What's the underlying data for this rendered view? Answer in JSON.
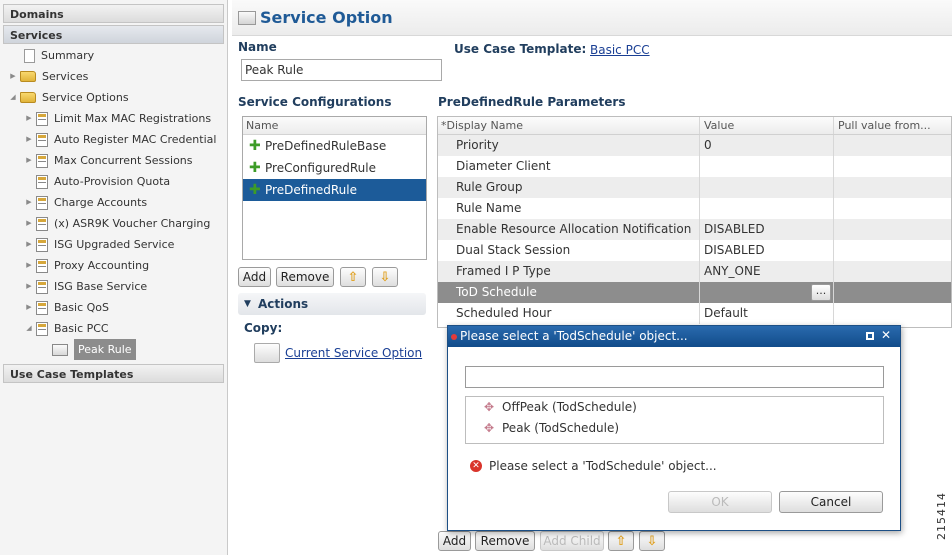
{
  "nav": {
    "domains": "Domains",
    "services": "Services",
    "use_case_templates": "Use Case Templates",
    "tree": [
      {
        "label": "Summary"
      },
      {
        "label": "Services"
      },
      {
        "label": "Service Options"
      },
      {
        "label": "Limit Max MAC Registrations"
      },
      {
        "label": "Auto Register MAC Credential"
      },
      {
        "label": "Max Concurrent Sessions"
      },
      {
        "label": "Auto-Provision Quota"
      },
      {
        "label": "Charge Accounts"
      },
      {
        "label": "(x) ASR9K Voucher Charging"
      },
      {
        "label": "ISG Upgraded Service"
      },
      {
        "label": "Proxy Accounting"
      },
      {
        "label": "ISG Base Service"
      },
      {
        "label": "Basic QoS"
      },
      {
        "label": "Basic PCC"
      },
      {
        "label": "Peak Rule"
      }
    ]
  },
  "main": {
    "title": "Service Option",
    "name_label": "Name",
    "name_value": "Peak Rule",
    "use_case_label": "Use Case Template:",
    "use_case_link": "Basic PCC",
    "service_configs_label": "Service Configurations",
    "configs_header": "Name",
    "configs": [
      {
        "label": "PreDefinedRuleBase"
      },
      {
        "label": "PreConfiguredRule"
      },
      {
        "label": "PreDefinedRule"
      }
    ],
    "add_label": "Add",
    "remove_label": "Remove",
    "actions_label": "Actions",
    "copy_label": "Copy:",
    "current_service_option": "Current Service Option",
    "params_label": "PreDefinedRule Parameters",
    "params_headers": [
      "*Display Name",
      "Value",
      "Pull value from..."
    ],
    "params": [
      {
        "name": "Priority",
        "value": "0"
      },
      {
        "name": "Diameter Client",
        "value": ""
      },
      {
        "name": "Rule Group",
        "value": ""
      },
      {
        "name": "Rule Name",
        "value": ""
      },
      {
        "name": "Enable Resource Allocation Notification",
        "value": "DISABLED"
      },
      {
        "name": "Dual Stack Session",
        "value": "DISABLED"
      },
      {
        "name": "Framed I P Type",
        "value": "ANY_ONE"
      },
      {
        "name": "ToD Schedule",
        "value": ""
      },
      {
        "name": "Scheduled Hour",
        "value": "Default"
      }
    ],
    "ellipsis": "...",
    "bottom_add": "Add",
    "bottom_remove": "Remove",
    "bottom_add_child": "Add Child"
  },
  "dialog": {
    "title": "Please select a 'TodSchedule' object...",
    "filter_value": "",
    "items": [
      {
        "label": "OffPeak (TodSchedule)"
      },
      {
        "label": "Peak (TodSchedule)"
      }
    ],
    "message": "Please select a 'TodSchedule' object...",
    "ok_label": "OK",
    "cancel_label": "Cancel"
  },
  "figure_number": "215414"
}
